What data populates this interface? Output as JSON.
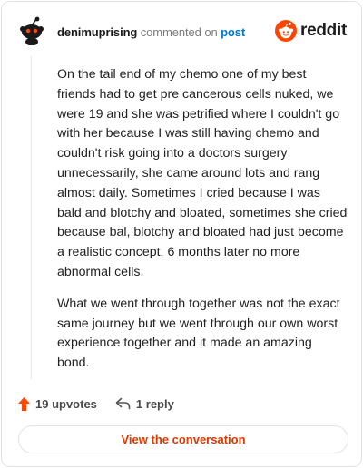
{
  "comment": {
    "author": "denimuprising",
    "action_text": "commented on",
    "target_text": "post",
    "paragraphs": [
      "On the tail end of my chemo one of my best friends had to get pre cancerous cells nuked, we were 19 and she was petrified where I couldn't go with her because I was still having chemo and couldn't risk going into a doctors surgery unnecessarily, she came around lots and rang almost daily. Sometimes I cried because I was bald and blotchy and bloated, sometimes she cried because bal, blotchy and bloated had just become a realistic concept, 6 months later no more abnormal cells.",
      "What we went through together was not the exact same journey but we went through our own worst experience together and it made an amazing bond."
    ],
    "upvotes_label": "19 upvotes",
    "replies_label": "1 reply"
  },
  "brand": {
    "wordmark": "reddit",
    "accent_color": "#ff4500"
  },
  "footer": {
    "view_button_label": "View the conversation"
  },
  "icons": {
    "avatar": "snoo-avatar-icon",
    "logo": "reddit-logo-icon",
    "upvote": "upvote-arrow-icon",
    "reply": "reply-arrow-icon"
  }
}
